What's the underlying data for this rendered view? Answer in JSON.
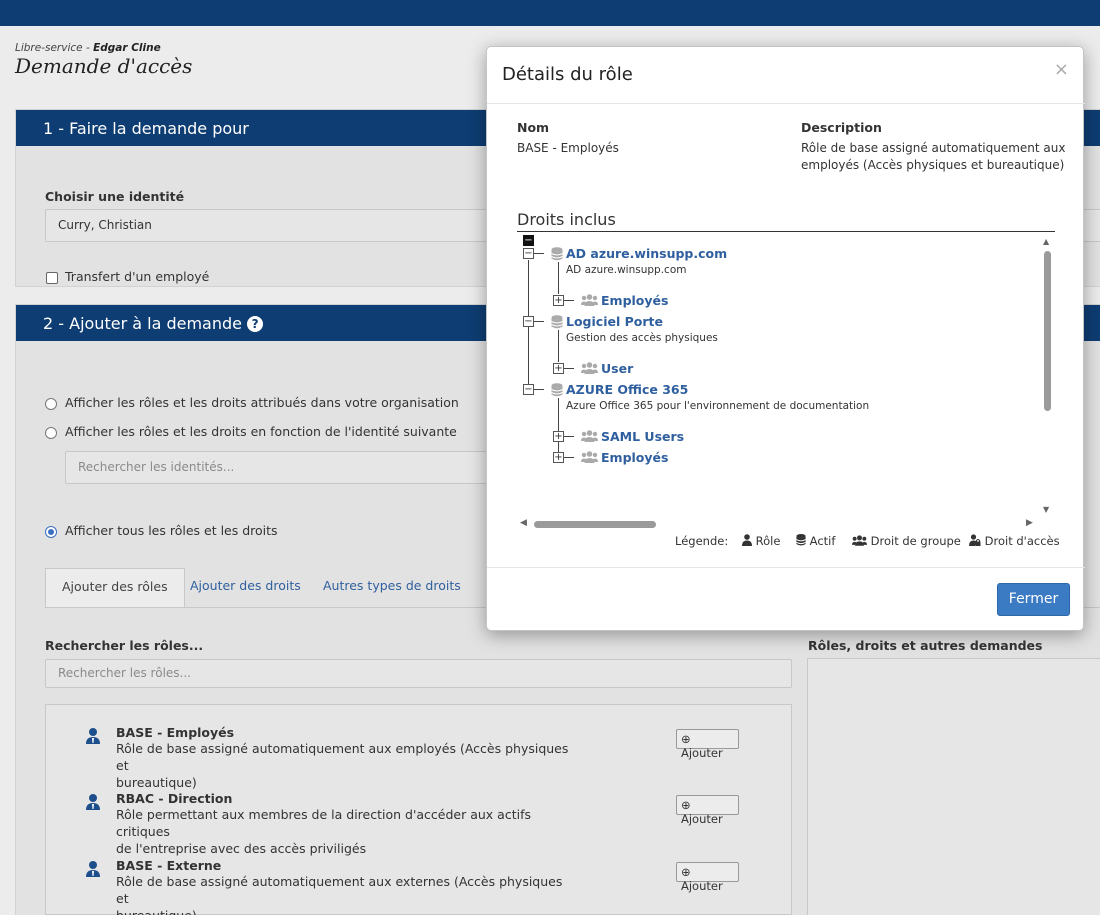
{
  "breadcrumb": {
    "prefix": "Libre-service - ",
    "user": "Edgar Cline"
  },
  "page_title": "Demande d'accès",
  "section1": {
    "title": "1 - Faire la demande pour",
    "identity_label": "Choisir une identité",
    "identity_value": "Curry, Christian",
    "transfer_label": "Transfert d'un employé"
  },
  "section2": {
    "title": "2 - Ajouter à la demande",
    "radio_org": "Afficher les rôles et les droits attribués dans votre organisation",
    "radio_identity": "Afficher les rôles et les droits en fonction de l'identité suivante",
    "identity_search_placeholder": "Rechercher les identités...",
    "radio_all": "Afficher tous les rôles et les droits",
    "tabs": [
      "Ajouter des rôles",
      "Ajouter des droits",
      "Autres types de droits"
    ],
    "search_roles_label": "Rechercher les rôles...",
    "search_roles_placeholder": "Rechercher les rôles...",
    "right_column_label": "Rôles, droits et autres demandes",
    "add_label": "Ajouter",
    "roles": [
      {
        "title": "BASE - Employés",
        "desc1": "Rôle de base assigné automatiquement aux employés (Accès physiques et",
        "desc2": "bureautique)"
      },
      {
        "title": "RBAC - Direction",
        "desc1": "Rôle permettant aux membres de la direction d'accéder aux actifs critiques",
        "desc2": "de l'entreprise avec des accès priviligés"
      },
      {
        "title": "BASE - Externe",
        "desc1": "Rôle de base assigné automatiquement aux externes (Accès physiques et",
        "desc2": "bureautique)"
      }
    ]
  },
  "modal": {
    "title": "Détails du rôle",
    "close_symbol": "×",
    "name_label": "Nom",
    "name_value": "BASE - Employés",
    "desc_label": "Description",
    "desc_line1": "Rôle de base assigné automatiquement aux",
    "desc_line2": "employés (Accès physiques et bureautique)",
    "rights_title": "Droits inclus",
    "tree": [
      {
        "name": "AD azure.winsupp.com",
        "sub": "AD azure.winsupp.com",
        "children": [
          "Employés"
        ]
      },
      {
        "name": "Logiciel Porte",
        "sub": "Gestion des accès physiques",
        "children": [
          "User"
        ]
      },
      {
        "name": "AZURE Office 365",
        "sub": "Azure Office 365 pour l'environnement de documentation",
        "children": [
          "SAML Users",
          "Employés"
        ]
      }
    ],
    "legend": {
      "label": "Légende:",
      "role": "Rôle",
      "asset": "Actif",
      "group_right": "Droit de groupe",
      "access_right": "Droit d'accès"
    },
    "close_button": "Fermer"
  },
  "colors": {
    "header": "#0e3d73",
    "link": "#2f5f9e",
    "primary_button": "#3a7bc4"
  }
}
